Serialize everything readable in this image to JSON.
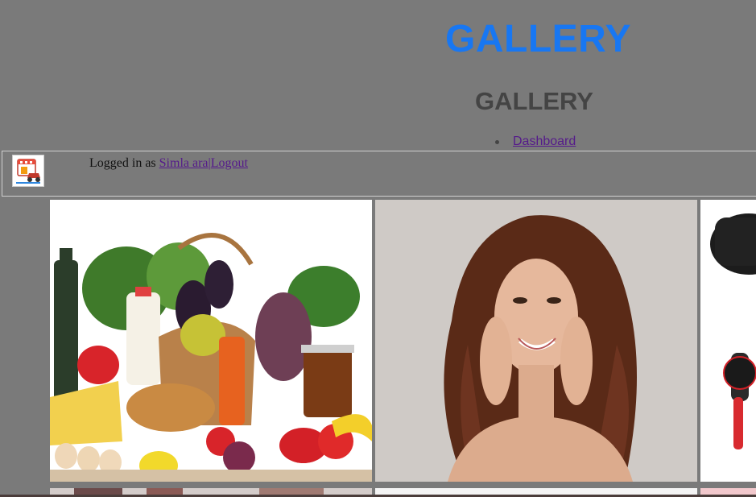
{
  "header": {
    "title": "GALLERY",
    "subtitle": "GALLERY"
  },
  "nav": {
    "items": [
      {
        "label": "Dashboard"
      }
    ]
  },
  "user_bar": {
    "logged_in_prefix": "Logged in as ",
    "username": "Simla ara",
    "separator": "|",
    "logout_label": "Logout",
    "logo_icon": "shop-delivery-logo-icon"
  },
  "gallery": {
    "images": [
      {
        "name": "groceries-photo"
      },
      {
        "name": "curly-hair-woman-photo"
      },
      {
        "name": "hair-dryer-brush-photo"
      },
      {
        "name": "gallery-image-row2-1"
      },
      {
        "name": "gallery-image-row2-2"
      },
      {
        "name": "gallery-image-row2-3"
      }
    ]
  },
  "colors": {
    "background": "#7a7a7a",
    "title": "#1877f2",
    "subtitle": "#444444",
    "link": "#551a8b"
  }
}
